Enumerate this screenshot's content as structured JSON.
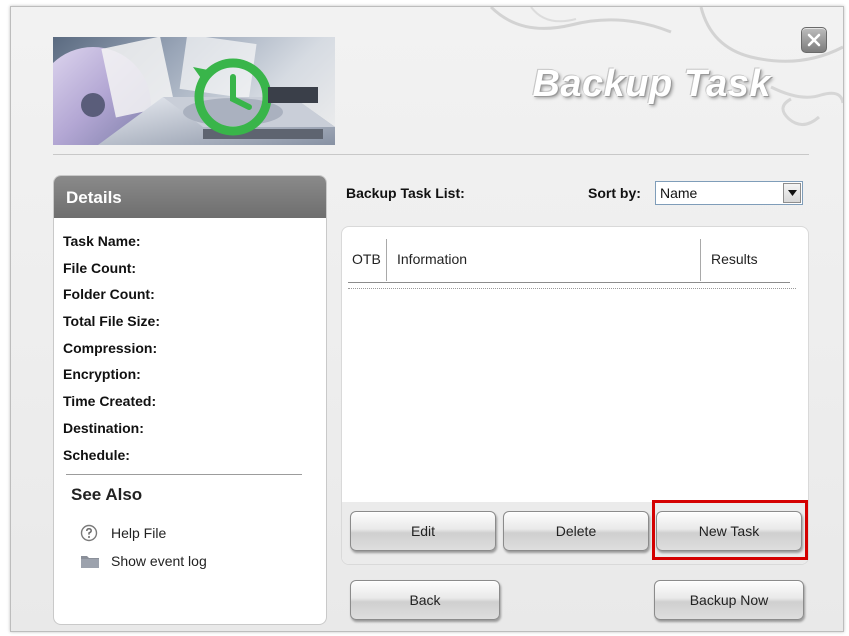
{
  "window": {
    "title": "Backup Task",
    "close_icon": "close-x-icon"
  },
  "details": {
    "heading": "Details",
    "fields": [
      "Task Name:",
      "File Count:",
      "Folder Count:",
      "Total File Size:",
      "Compression:",
      "Encryption:",
      "Time Created:",
      "Destination:",
      "Schedule:"
    ],
    "see_also": "See Also",
    "links": [
      {
        "label": "Help File",
        "icon": "help-circle-icon"
      },
      {
        "label": "Show event log",
        "icon": "folder-icon"
      }
    ]
  },
  "task_list": {
    "label": "Backup Task List:",
    "sort_label": "Sort by:",
    "sort_value": "Name",
    "columns": [
      "OTB",
      "Information",
      "Results"
    ],
    "rows": []
  },
  "buttons": {
    "edit": "Edit",
    "delete": "Delete",
    "new_task": "New Task",
    "back": "Back",
    "backup_now": "Backup Now"
  },
  "colors": {
    "highlight": "#d40000",
    "panel_header": "#7a7a7a"
  }
}
